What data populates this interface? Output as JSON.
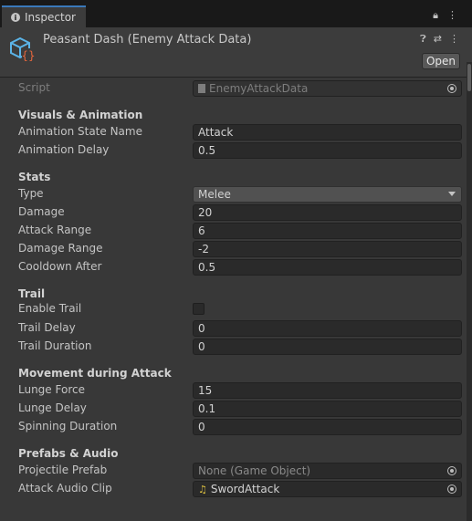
{
  "tab": {
    "label": "Inspector"
  },
  "header": {
    "title": "Peasant Dash (Enemy Attack Data)",
    "open_label": "Open"
  },
  "script": {
    "label": "Script",
    "value": "EnemyAttackData"
  },
  "sections": {
    "visuals": "Visuals & Animation",
    "stats": "Stats",
    "trail": "Trail",
    "movement": "Movement during Attack",
    "prefabs": "Prefabs & Audio"
  },
  "fields": {
    "animation_state_name": {
      "label": "Animation State Name",
      "value": "Attack"
    },
    "animation_delay": {
      "label": "Animation Delay",
      "value": "0.5"
    },
    "type": {
      "label": "Type",
      "value": "Melee"
    },
    "damage": {
      "label": "Damage",
      "value": "20"
    },
    "attack_range": {
      "label": "Attack Range",
      "value": "6"
    },
    "damage_range": {
      "label": "Damage Range",
      "value": "-2"
    },
    "cooldown_after": {
      "label": "Cooldown After",
      "value": "0.5"
    },
    "enable_trail": {
      "label": "Enable Trail",
      "checked": false
    },
    "trail_delay": {
      "label": "Trail Delay",
      "value": "0"
    },
    "trail_duration": {
      "label": "Trail Duration",
      "value": "0"
    },
    "lunge_force": {
      "label": "Lunge Force",
      "value": "15"
    },
    "lunge_delay": {
      "label": "Lunge Delay",
      "value": "0.1"
    },
    "spinning_duration": {
      "label": "Spinning Duration",
      "value": "0"
    },
    "projectile_prefab": {
      "label": "Projectile Prefab",
      "value": "None (Game Object)"
    },
    "attack_audio_clip": {
      "label": "Attack Audio Clip",
      "value": "SwordAttack"
    }
  }
}
